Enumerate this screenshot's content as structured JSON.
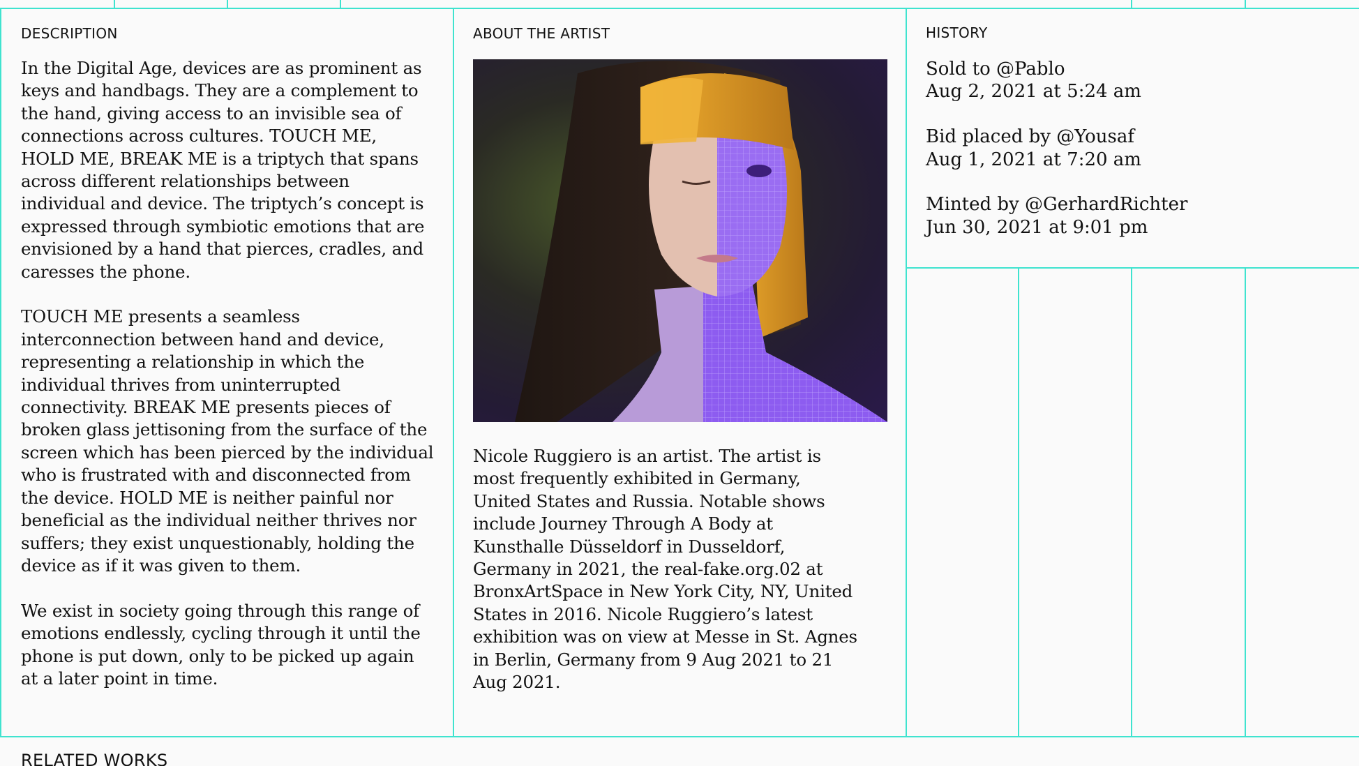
{
  "description": {
    "label": "DESCRIPTION",
    "paragraphs": [
      "In the Digital Age, devices are as prominent as keys and handbags. They are a complement to the hand, giving access to an invisible sea of connections across cultures. TOUCH ME, HOLD ME, BREAK ME is a triptych that spans across different relationships between individual and device. The triptych’s concept is expressed through symbiotic emotions that are envisioned by a hand that pierces, cradles, and caresses the phone.",
      "TOUCH ME presents a seamless interconnection between hand and device, representing a relationship in which the individual thrives from uninterrupted connectivity. BREAK ME presents pieces of broken glass jettisoning from the surface of the screen which has been pierced by the individual who is frustrated with and disconnected from the device. HOLD ME is neither painful nor beneficial as the individual neither thrives nor suffers; they exist unquestionably, holding the device as if it was given to them.",
      "We exist in society going through this range of emotions endlessly, cycling through it until the phone is put down, only to be picked up again at a later point in time."
    ]
  },
  "artist": {
    "label": "ABOUT THE ARTIST",
    "bio": "Nicole Ruggiero is an artist. The artist is most frequently exhibited in Germany, United States and Russia. Notable shows include Journey Through A Body at Kunsthalle Düsseldorf in Dusseldorf, Germany in 2021, the real-fake.org.02 at BronxArtSpace in New York City, NY, United States in 2016. Nicole Ruggiero’s latest exhibition was on view at Messe in St. Agnes in Berlin, Germany from 9 Aug 2021 to 21 Aug 2021."
  },
  "history": {
    "label": "HISTORY",
    "entries": [
      {
        "action": "Sold to @Pablo",
        "date": "Aug 2, 2021 at 5:24 am"
      },
      {
        "action": "Bid placed by @Yousaf",
        "date": "Aug 1, 2021 at 7:20 am"
      },
      {
        "action": "Minted by @GerhardRichter",
        "date": "Jun 30, 2021 at 9:01 pm"
      }
    ]
  },
  "related": {
    "label": "RELATED WORKS"
  },
  "colors": {
    "grid_line": "#3fe3cf",
    "background": "#fafafa",
    "hair_orange": "#e8a020",
    "wireframe_purple": "#9b6cf0"
  }
}
